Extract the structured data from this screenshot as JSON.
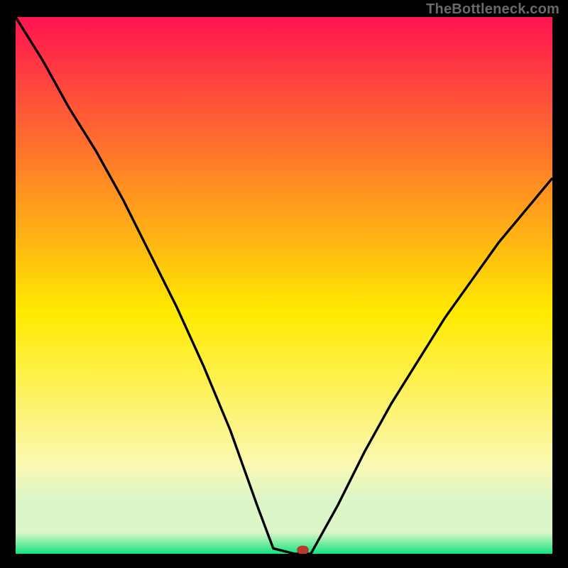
{
  "watermark": "TheBottleneck.com",
  "colors": {
    "top": "#ff1450",
    "mid_warm": "#ffea00",
    "mid_light": "#fbf8b0",
    "band": "#dcf6c8",
    "bottom": "#14e27e",
    "frame": "#000000",
    "curve": "#000000",
    "marker": "#b8392e"
  },
  "chart_data": {
    "type": "line",
    "title": "",
    "xlabel": "",
    "ylabel": "",
    "xlim": [
      0,
      100
    ],
    "ylim": [
      0,
      100
    ],
    "x": [
      0,
      5,
      10,
      15,
      20,
      25,
      30,
      35,
      40,
      45,
      48,
      52,
      55,
      60,
      65,
      70,
      75,
      80,
      85,
      90,
      95,
      100
    ],
    "values": [
      100,
      92,
      83,
      75,
      66,
      56,
      46,
      35,
      23,
      9,
      1,
      0,
      0,
      9,
      19,
      28,
      36,
      44,
      51,
      58,
      64,
      70
    ],
    "grid": false,
    "legend": false,
    "marker": {
      "x": 53.5,
      "y": 0.7
    }
  }
}
